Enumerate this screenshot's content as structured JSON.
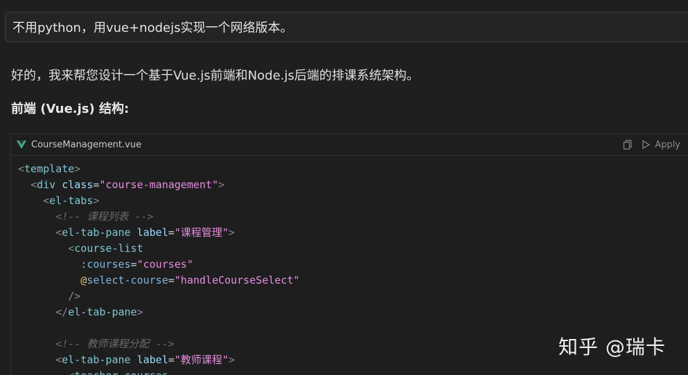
{
  "user_message": "不用python，用vue+nodejs实现一个网络版本。",
  "answer": {
    "intro": "好的，我来帮您设计一个基于Vue.js前端和Node.js后端的排课系统架构。",
    "section_heading": "前端 (Vue.js) 结构:"
  },
  "code_block": {
    "file_name": "CourseManagement.vue",
    "file_icon": "vue-logo-icon",
    "actions": {
      "copy_icon": "copy-icon",
      "apply_label": "Apply"
    },
    "lines": [
      [
        {
          "t": "<",
          "c": "br"
        },
        {
          "t": "template",
          "c": "tag"
        },
        {
          "t": ">",
          "c": "br"
        }
      ],
      [
        {
          "t": "  ",
          "c": "plain"
        },
        {
          "t": "<",
          "c": "br"
        },
        {
          "t": "div",
          "c": "tag"
        },
        {
          "t": " ",
          "c": "plain"
        },
        {
          "t": "class",
          "c": "attr"
        },
        {
          "t": "=",
          "c": "plain"
        },
        {
          "t": "\"course-management\"",
          "c": "str"
        },
        {
          "t": ">",
          "c": "br"
        }
      ],
      [
        {
          "t": "    ",
          "c": "plain"
        },
        {
          "t": "<",
          "c": "br"
        },
        {
          "t": "el-tabs",
          "c": "tag"
        },
        {
          "t": ">",
          "c": "br"
        }
      ],
      [
        {
          "t": "      ",
          "c": "plain"
        },
        {
          "t": "<!-- 课程列表 -->",
          "c": "cmt"
        }
      ],
      [
        {
          "t": "      ",
          "c": "plain"
        },
        {
          "t": "<",
          "c": "br"
        },
        {
          "t": "el-tab-pane",
          "c": "tag"
        },
        {
          "t": " ",
          "c": "plain"
        },
        {
          "t": "label",
          "c": "attr"
        },
        {
          "t": "=",
          "c": "plain"
        },
        {
          "t": "\"课程管理\"",
          "c": "str"
        },
        {
          "t": ">",
          "c": "br"
        }
      ],
      [
        {
          "t": "        ",
          "c": "plain"
        },
        {
          "t": "<",
          "c": "br"
        },
        {
          "t": "course-list",
          "c": "tag"
        }
      ],
      [
        {
          "t": "          ",
          "c": "plain"
        },
        {
          "t": ":courses",
          "c": "attr2"
        },
        {
          "t": "=",
          "c": "plain"
        },
        {
          "t": "\"courses\"",
          "c": "str"
        }
      ],
      [
        {
          "t": "          ",
          "c": "plain"
        },
        {
          "t": "@",
          "c": "at"
        },
        {
          "t": "select-course",
          "c": "attr2"
        },
        {
          "t": "=",
          "c": "plain"
        },
        {
          "t": "\"handleCourseSelect\"",
          "c": "str"
        }
      ],
      [
        {
          "t": "        ",
          "c": "plain"
        },
        {
          "t": "/>",
          "c": "br"
        }
      ],
      [
        {
          "t": "      ",
          "c": "plain"
        },
        {
          "t": "</",
          "c": "br"
        },
        {
          "t": "el-tab-pane",
          "c": "tag"
        },
        {
          "t": ">",
          "c": "br"
        }
      ],
      [
        {
          "t": "",
          "c": "plain"
        }
      ],
      [
        {
          "t": "      ",
          "c": "plain"
        },
        {
          "t": "<!-- 教师课程分配 -->",
          "c": "cmt"
        }
      ],
      [
        {
          "t": "      ",
          "c": "plain"
        },
        {
          "t": "<",
          "c": "br"
        },
        {
          "t": "el-tab-pane",
          "c": "tag"
        },
        {
          "t": " ",
          "c": "plain"
        },
        {
          "t": "label",
          "c": "attr"
        },
        {
          "t": "=",
          "c": "plain"
        },
        {
          "t": "\"教师课程\"",
          "c": "str"
        },
        {
          "t": ">",
          "c": "br"
        }
      ],
      [
        {
          "t": "        ",
          "c": "plain"
        },
        {
          "t": "<",
          "c": "br"
        },
        {
          "t": "teacher-courses",
          "c": "tag"
        }
      ]
    ]
  },
  "watermark": "知乎 @瑞卡"
}
